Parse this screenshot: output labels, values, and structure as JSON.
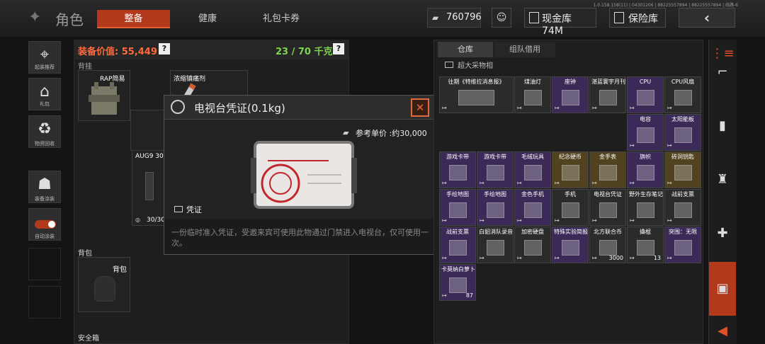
{
  "header": {
    "title": "角色",
    "tabs": [
      "整备",
      "健康",
      "礼包卡券"
    ],
    "version": "1.0.158.158(11) | 04301206 | 88225557894 | 88225557894 | 线路-6",
    "currency": "760796",
    "cash_vault": "现金库 74M",
    "safe_vault": "保险库"
  },
  "left_menu": [
    "起装推荐",
    "礼包",
    "物资回收",
    "装备涂装",
    "自动涂装"
  ],
  "equipment": {
    "value_label": "装备价值: 55,449",
    "weight": "23 / 70 千克",
    "help": "?",
    "section_vest": "背挂",
    "vest_item": "RAP简易",
    "slot2_item": "浓缩镇痛剂",
    "aug_item": "AUG9 30",
    "aug_count": "30/30",
    "backpack_section": "背包",
    "backpack_label": "背包",
    "safe_section": "安全箱"
  },
  "popup": {
    "title": "电视台凭证(0.1kg)",
    "price": "参考单价 :约30,000",
    "category": "凭证",
    "description": "一份临时准入凭证，受邀来宾可使用此物通过门禁进入电视台，仅可使用一次。",
    "close": "✕"
  },
  "storage": {
    "tabs": [
      "仓库",
      "组队借用"
    ],
    "sub_label": "超大采物相",
    "items": [
      {
        "name": "往期《特维拉消息报》",
        "color": "gray"
      },
      {
        "name": "煤油灯",
        "color": "gray"
      },
      {
        "name": "座钟",
        "color": "purple"
      },
      {
        "name": "湛蓝寰宇月刊",
        "color": "gray"
      },
      {
        "name": "CPU",
        "color": "purple"
      },
      {
        "name": "CPU风扇",
        "color": "gray"
      },
      {
        "name": "电容",
        "color": "purple"
      },
      {
        "name": "太阳能板",
        "color": "purple"
      },
      {
        "name": "游戏卡带",
        "color": "purple"
      },
      {
        "name": "游戏卡带",
        "color": "purple"
      },
      {
        "name": "毛绒玩具",
        "color": "purple"
      },
      {
        "name": "纪念硬币",
        "color": "gold"
      },
      {
        "name": "金手表",
        "color": "gold"
      },
      {
        "name": "旗帜",
        "color": "purple"
      },
      {
        "name": "砖洞钥匙",
        "color": "gold"
      },
      {
        "name": "手绘地图",
        "color": "purple"
      },
      {
        "name": "手绘地图",
        "color": "purple"
      },
      {
        "name": "金色手机",
        "color": "purple"
      },
      {
        "name": "手机",
        "color": "gray"
      },
      {
        "name": "电视台凭证",
        "color": "gray"
      },
      {
        "name": "野外生存笔记",
        "color": "gray"
      },
      {
        "name": "战前支票",
        "color": "gray"
      },
      {
        "name": "战前支票",
        "color": "purple"
      },
      {
        "name": "白貂消队录音带",
        "color": "gray"
      },
      {
        "name": "加密硬盘",
        "color": "gray"
      },
      {
        "name": "特殊实验简报记录",
        "color": "purple"
      },
      {
        "name": "北方联合币",
        "color": "gray",
        "qty": "3000"
      },
      {
        "name": "撬棍",
        "color": "gray",
        "qty": "13"
      },
      {
        "name": "突围：无限",
        "color": "purple"
      },
      {
        "name": "卡莫纳白萝卜",
        "color": "purple",
        "qty": "87"
      }
    ]
  },
  "colors": {
    "accent": "#b3391c",
    "purple": "#3b2a57",
    "gold": "#51431f",
    "value_text": "#ff6a3d",
    "weight_text": "#7fd34f"
  }
}
